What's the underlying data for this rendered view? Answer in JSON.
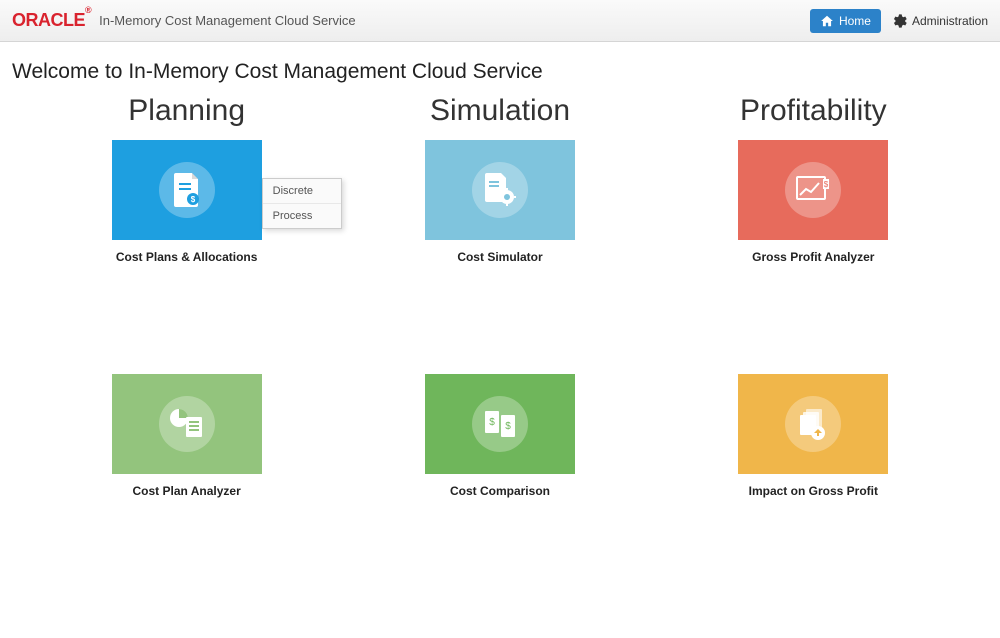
{
  "header": {
    "brand": "ORACLE",
    "subtitle": "In-Memory Cost Management Cloud Service",
    "home_label": "Home",
    "admin_label": "Administration"
  },
  "welcome": "Welcome to In-Memory Cost Management Cloud Service",
  "columns": {
    "planning": {
      "title": "Planning",
      "tile1_label": "Cost Plans & Allocations",
      "tile2_label": "Cost Plan Analyzer",
      "popup_item1": "Discrete",
      "popup_item2": "Process"
    },
    "simulation": {
      "title": "Simulation",
      "tile1_label": "Cost Simulator",
      "tile2_label": "Cost Comparison"
    },
    "profitability": {
      "title": "Profitability",
      "tile1_label": "Gross Profit Analyzer",
      "tile2_label": "Impact on Gross Profit"
    }
  }
}
